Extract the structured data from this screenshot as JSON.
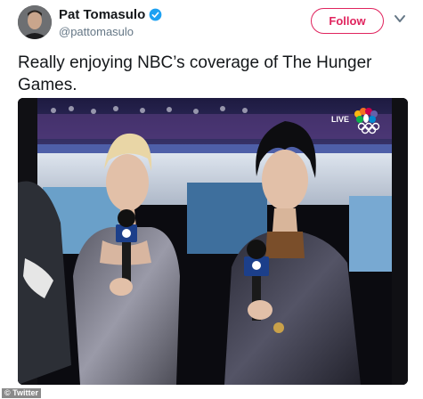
{
  "user": {
    "display_name": "Pat Tomasulo",
    "handle": "@pattomasulo",
    "verified": true,
    "avatar_icon": "profile-photo"
  },
  "follow_label": "Follow",
  "tweet_text": "Really enjoying NBC’s coverage of The Hunger Games.",
  "photo": {
    "live_badge": "LIVE",
    "network": "NBC"
  },
  "image_credit": "© Twitter",
  "colors": {
    "follow": "#e0245e",
    "verified": "#1da1f2",
    "text": "#14171a",
    "secondary": "#657786"
  }
}
